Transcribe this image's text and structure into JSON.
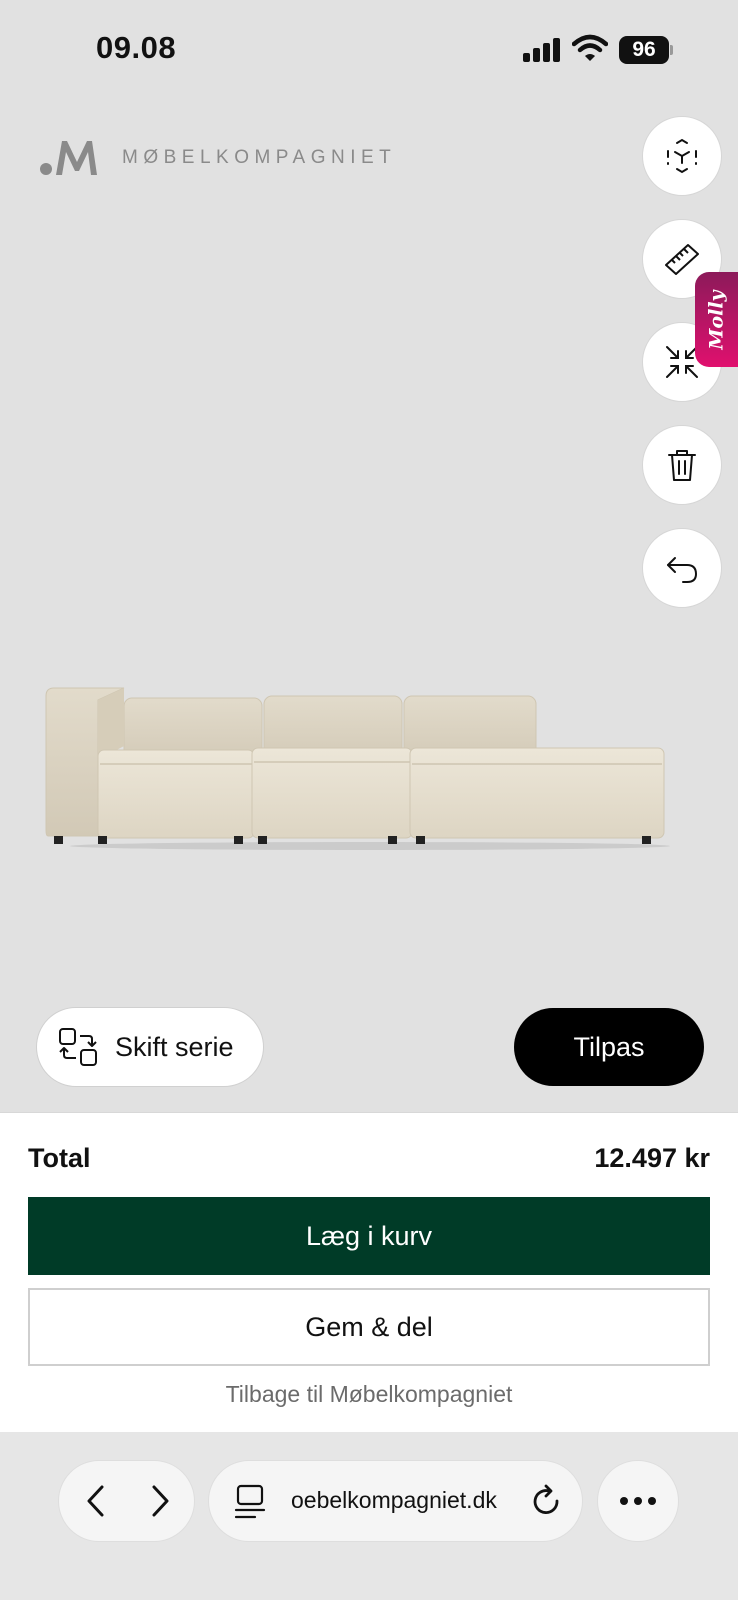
{
  "status_bar": {
    "time": "09.08",
    "battery": "96"
  },
  "brand": {
    "name": "MØBELKOMPAGNIET"
  },
  "tools": [
    {
      "icon": "ar-view-icon"
    },
    {
      "icon": "ruler-icon"
    },
    {
      "icon": "collapse-arrows-icon"
    },
    {
      "icon": "trash-icon"
    },
    {
      "icon": "undo-icon"
    }
  ],
  "molly": {
    "label": "Molly"
  },
  "actions": {
    "switch_series": "Skift serie",
    "customize": "Tilpas"
  },
  "summary": {
    "total_label": "Total",
    "total_value": "12.497 kr",
    "add_to_cart": "Læg i kurv",
    "save_share": "Gem & del",
    "back_link": "Tilbage til Møbelkompagniet"
  },
  "browser": {
    "url": "oebelkompagniet.dk"
  },
  "colors": {
    "cart_button": "#003b27",
    "molly_tab": "#e0106e",
    "background": "#e1e1e1",
    "customize_button": "#000000"
  }
}
